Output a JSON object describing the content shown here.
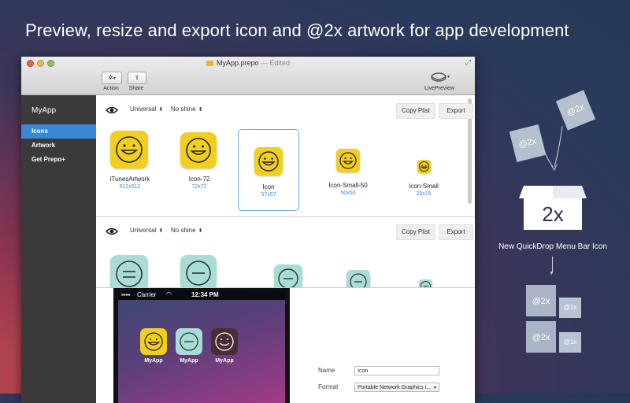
{
  "headline": "Preview, resize and export icon and @2x artwork for app development",
  "window": {
    "title": "MyApp.prepo",
    "edited": "— Edited",
    "toolbar": {
      "action_label": "Action",
      "share_label": "Share",
      "livepreview_label": "LivePreview"
    }
  },
  "sidebar": {
    "title": "MyApp",
    "items": [
      {
        "label": "Icons",
        "active": true
      },
      {
        "label": "Artwork",
        "active": false
      },
      {
        "label": "Get Prepo+",
        "active": false
      }
    ]
  },
  "rows": [
    {
      "device": "Universal",
      "shine": "No shine",
      "copy_label": "Copy Plist",
      "export_label": "Export",
      "icons": [
        {
          "name": "iTunesArtwork",
          "size": "512x512"
        },
        {
          "name": "Icon-72",
          "size": "72x72"
        },
        {
          "name": "Icon",
          "size": "57x57",
          "selected": true
        },
        {
          "name": "Icon-Small-50",
          "size": "50x50"
        },
        {
          "name": "Icon-Small",
          "size": "29x29"
        }
      ]
    },
    {
      "device": "Universal",
      "shine": "No shine",
      "copy_label": "Copy Plist",
      "export_label": "Export"
    }
  ],
  "phone": {
    "carrier": "Carrier",
    "time": "12:34 PM",
    "apps": [
      {
        "label": "MyApp",
        "color": "#f2cf1f"
      },
      {
        "label": "MyApp",
        "color": "#a8ddd5"
      },
      {
        "label": "MyApp",
        "color": "#4a2c35"
      }
    ]
  },
  "properties": {
    "name_label": "Name",
    "name_value": "Icon",
    "format_label": "Format",
    "format_value": "Portable Network Graphics i..."
  },
  "promo": {
    "file_tag_1": "@2x",
    "file_tag_2": "@2x",
    "badge": "2x",
    "caption": "New QuickDrop Menu Bar Icon",
    "out_tags": [
      "@2x",
      "@1x",
      "@2x",
      "@1x"
    ]
  },
  "colors": {
    "accent": "#3b88d6",
    "icon_yellow": "#f2cf1f",
    "icon_teal": "#a8ddd5",
    "sidebar_bg": "#3a3a3a"
  }
}
